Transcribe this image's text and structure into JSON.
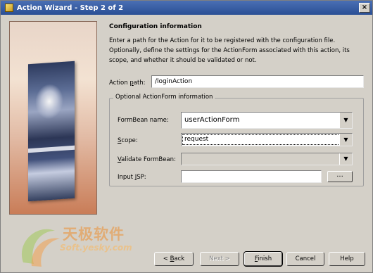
{
  "window": {
    "title": "Action Wizard - Step 2 of 2",
    "close_glyph": "×"
  },
  "content": {
    "heading": "Configuration information",
    "description": "Enter a path for the Action for it to be registered with the configuration file. Optionally, define the settings for the ActionForm associated with this action, its scope, and whether it should be validated or not.",
    "action_path": {
      "label_pre": "Action ",
      "label_u": "p",
      "label_post": "ath:",
      "value": "/loginAction"
    }
  },
  "optional_group": {
    "title": "Optional ActionForm information",
    "formbean": {
      "label": "FormBean name:",
      "value": "userActionForm"
    },
    "scope": {
      "label_u": "S",
      "label_post": "cope:",
      "value": "request"
    },
    "validate": {
      "label_u": "V",
      "label_post": "alidate FormBean:",
      "value": ""
    },
    "input_jsp": {
      "label_pre": "Input ",
      "label_u": "J",
      "label_post": "SP:",
      "value": "",
      "browse_label": "..."
    }
  },
  "buttons": {
    "back": {
      "glyph": "< ",
      "u": "B",
      "rest": "ack"
    },
    "next": "Next >",
    "finish": {
      "u": "F",
      "rest": "inish"
    },
    "cancel": "Cancel",
    "help": "Help"
  },
  "watermark": {
    "text": "天极软件",
    "url": "Soft.yesky.com"
  },
  "icons": {
    "dropdown": "▼"
  },
  "colors": {
    "titlebar": "#2a4f95",
    "window": "#d4d0c8"
  }
}
